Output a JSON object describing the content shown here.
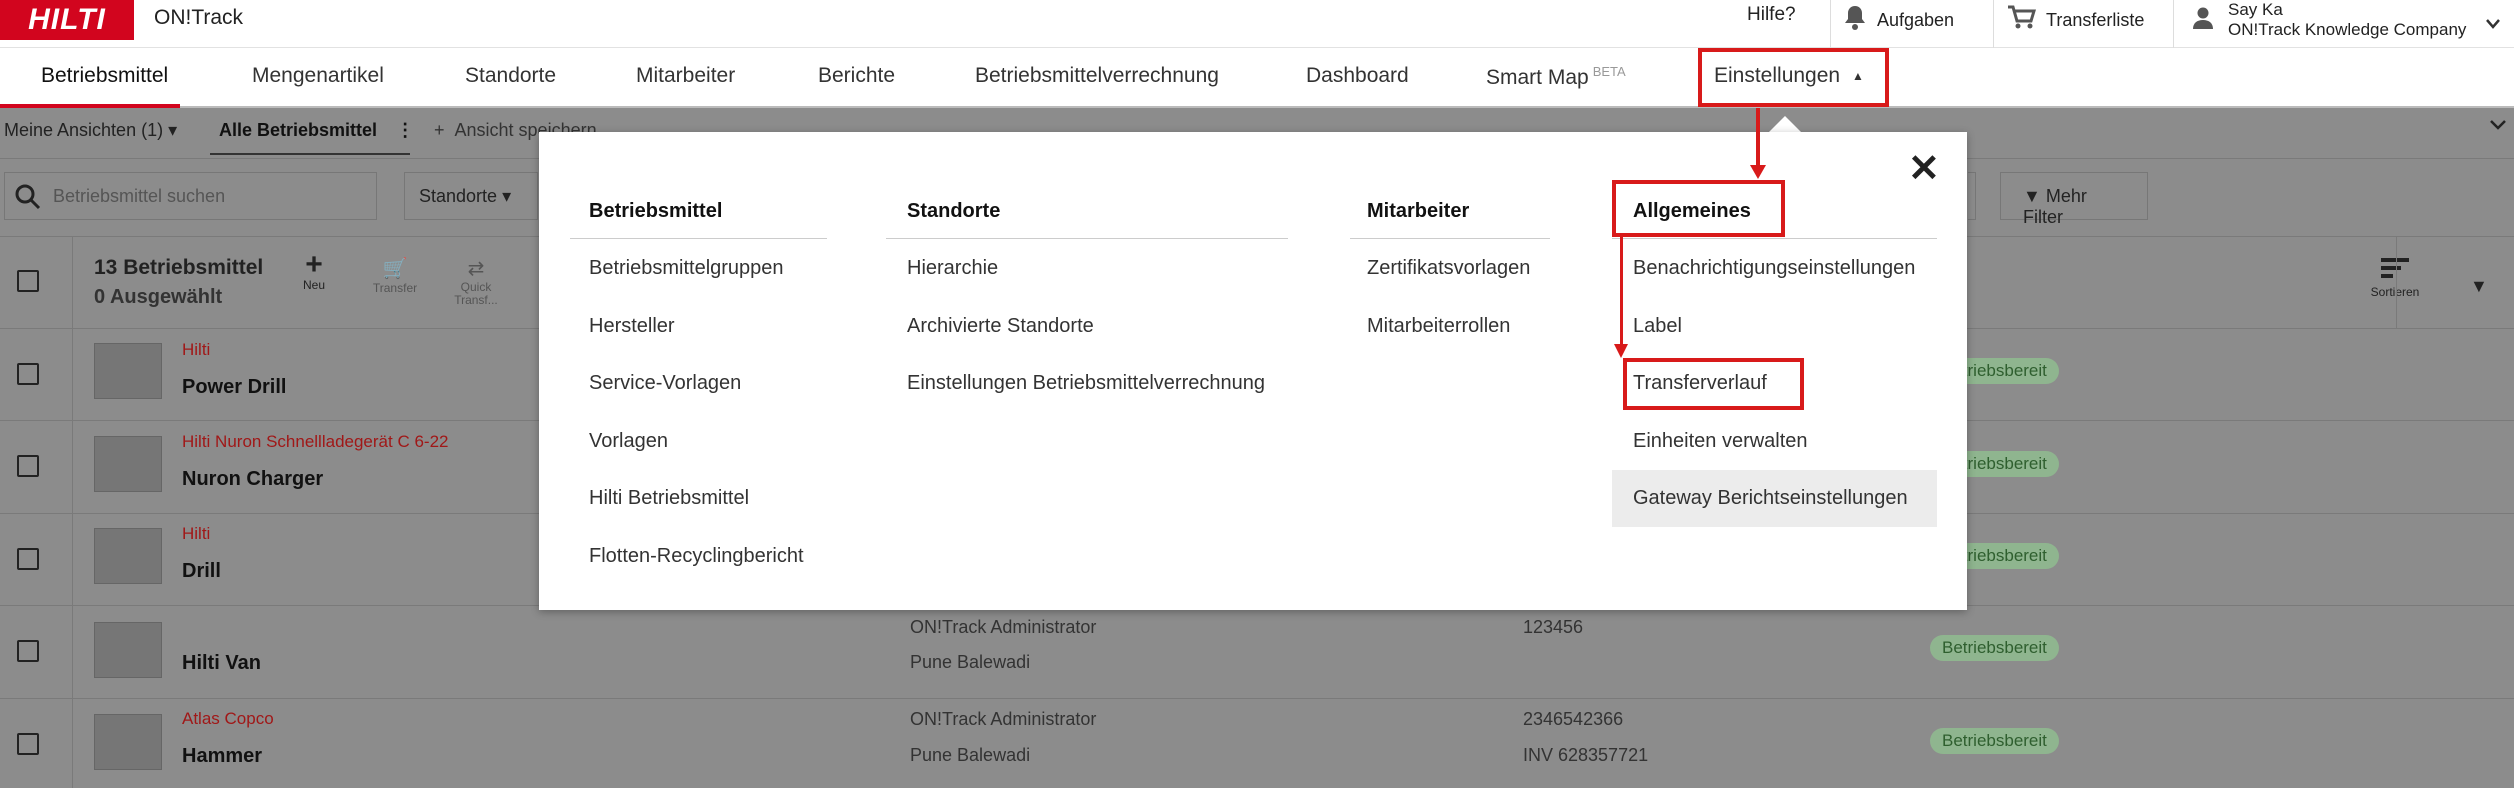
{
  "app": {
    "logo": "HILTI",
    "title": "ON!Track"
  },
  "top_links": {
    "help": "Hilfe?",
    "tasks": "Aufgaben",
    "transfer_list": "Transferliste",
    "user_name": "Say Ka",
    "company": "ON!Track Knowledge Company"
  },
  "nav": {
    "tabs": [
      {
        "label": "Betriebsmittel"
      },
      {
        "label": "Mengenartikel"
      },
      {
        "label": "Standorte"
      },
      {
        "label": "Mitarbeiter"
      },
      {
        "label": "Berichte"
      },
      {
        "label": "Betriebsmittelverrechnung"
      },
      {
        "label": "Dashboard"
      },
      {
        "label": "Smart Map",
        "badge": "BETA"
      },
      {
        "label": "Einstellungen",
        "caret": "▲"
      }
    ]
  },
  "views": {
    "my_views": "Meine Ansichten (1)",
    "all_assets": "Alle Betriebsmittel",
    "save_view": "Ansicht speichern"
  },
  "filters": {
    "search_placeholder": "Betriebsmittel suchen",
    "locations": "Standorte",
    "more_filters": "Mehr Filter"
  },
  "list_header": {
    "count": "13 Betriebsmittel",
    "selected": "0 Ausgewählt",
    "new": "Neu",
    "transfer": "Transfer",
    "quick_transfer": "Quick Transf...",
    "sort": "Sortieren"
  },
  "rows": [
    {
      "brand": "Hilti",
      "name": "Power Drill",
      "status": "Betriebsbereit"
    },
    {
      "brand": "Hilti Nuron Schnellladegerät C 6-22",
      "name": "Nuron Charger",
      "status": "Betriebsbereit"
    },
    {
      "brand": "Hilti",
      "name": "Drill",
      "status": "Betriebsbereit"
    },
    {
      "brand": "",
      "name": "Hilti Van",
      "owner": "ON!Track Administrator",
      "location": "Pune Balewadi",
      "id": "123456",
      "status": "Betriebsbereit"
    },
    {
      "brand": "Atlas Copco",
      "name": "Hammer",
      "owner": "ON!Track Administrator",
      "location": "Pune Balewadi",
      "id": "2346542366",
      "inv": "INV 628357721",
      "status": "Betriebsbereit"
    }
  ],
  "menu": {
    "columns": [
      {
        "heading": "Betriebsmittel",
        "items": [
          "Betriebsmittelgruppen",
          "Hersteller",
          "Service-Vorlagen",
          "Vorlagen",
          "Hilti Betriebsmittel",
          "Flotten-Recyclingbericht"
        ]
      },
      {
        "heading": "Standorte",
        "items": [
          "Hierarchie",
          "Archivierte Standorte",
          "Einstellungen Betriebsmittelverrechnung"
        ]
      },
      {
        "heading": "Mitarbeiter",
        "items": [
          "Zertifikatsvorlagen",
          "Mitarbeiterrollen"
        ]
      },
      {
        "heading": "Allgemeines",
        "items": [
          "Benachrichtigungseinstellungen",
          "Label",
          "Transferverlauf",
          "Einheiten verwalten",
          "Gateway Berichtseinstellungen"
        ]
      }
    ],
    "close": "✕"
  },
  "colors": {
    "brand_red": "#d2051e",
    "annotation_red": "#d81a1a",
    "status_green": "#8fb58f"
  }
}
